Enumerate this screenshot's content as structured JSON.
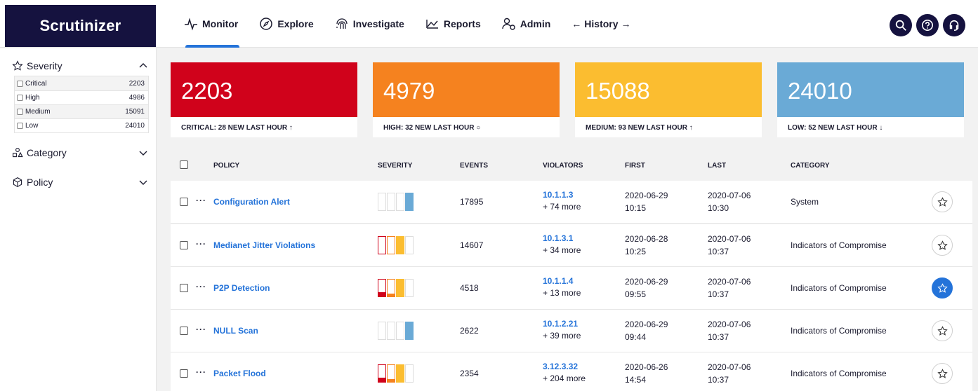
{
  "app": {
    "title": "Scrutinizer"
  },
  "nav": {
    "monitor": "Monitor",
    "explore": "Explore",
    "investigate": "Investigate",
    "reports": "Reports",
    "admin": "Admin",
    "history": "History"
  },
  "sidebar": {
    "severity": {
      "title": "Severity",
      "items": [
        {
          "label": "Critical",
          "count": "2203"
        },
        {
          "label": "High",
          "count": "4986"
        },
        {
          "label": "Medium",
          "count": "15091"
        },
        {
          "label": "Low",
          "count": "24010"
        }
      ]
    },
    "category": {
      "title": "Category"
    },
    "policy": {
      "title": "Policy"
    }
  },
  "cards": [
    {
      "value": "2203",
      "sub": "CRITICAL: 28 NEW LAST HOUR",
      "color": "#d0021b",
      "trend": "up"
    },
    {
      "value": "4979",
      "sub": "HIGH: 32 NEW LAST HOUR",
      "color": "#f5821f",
      "trend": "flat"
    },
    {
      "value": "15088",
      "sub": "MEDIUM: 93 NEW LAST HOUR",
      "color": "#fbbd30",
      "trend": "up"
    },
    {
      "value": "24010",
      "sub": "LOW: 52 NEW LAST HOUR",
      "color": "#6aaad6",
      "trend": "down"
    }
  ],
  "table": {
    "headers": {
      "policy": "POLICY",
      "severity": "SEVERITY",
      "events": "EVENTS",
      "violators": "VIOLATORS",
      "first": "FIRST",
      "last": "LAST",
      "category": "CATEGORY"
    },
    "rows": [
      {
        "policy": "Configuration Alert",
        "severity": "low",
        "events": "17895",
        "violator_ip": "10.1.1.3",
        "violator_more": "+ 74 more",
        "first_date": "2020-06-29",
        "first_time": "10:15",
        "last_date": "2020-07-06",
        "last_time": "10:30",
        "category": "System",
        "starred": false
      },
      {
        "policy": "Medianet Jitter Violations",
        "severity": "medium",
        "events": "14607",
        "violator_ip": "10.1.3.1",
        "violator_more": "+ 34 more",
        "first_date": "2020-06-28",
        "first_time": "10:25",
        "last_date": "2020-07-06",
        "last_time": "10:37",
        "category": "Indicators of Compromise",
        "starred": false
      },
      {
        "policy": "P2P Detection",
        "severity": "mixed",
        "events": "4518",
        "violator_ip": "10.1.1.4",
        "violator_more": "+ 13 more",
        "first_date": "2020-06-29",
        "first_time": "09:55",
        "last_date": "2020-07-06",
        "last_time": "10:37",
        "category": "Indicators of Compromise",
        "starred": true
      },
      {
        "policy": "NULL Scan",
        "severity": "low",
        "events": "2622",
        "violator_ip": "10.1.2.21",
        "violator_more": "+ 39 more",
        "first_date": "2020-06-29",
        "first_time": "09:44",
        "last_date": "2020-07-06",
        "last_time": "10:37",
        "category": "Indicators of Compromise",
        "starred": false
      },
      {
        "policy": "Packet Flood",
        "severity": "mixed",
        "events": "2354",
        "violator_ip": "3.12.3.32",
        "violator_more": "+ 204 more",
        "first_date": "2020-06-26",
        "first_time": "14:54",
        "last_date": "2020-07-06",
        "last_time": "10:37",
        "category": "Indicators of Compromise",
        "starred": false
      }
    ]
  },
  "colors": {
    "critical": "#d0021b",
    "high": "#f5821f",
    "medium": "#fbbd30",
    "low": "#6aaad6",
    "accent": "#2473d9",
    "brand": "#15123f"
  }
}
